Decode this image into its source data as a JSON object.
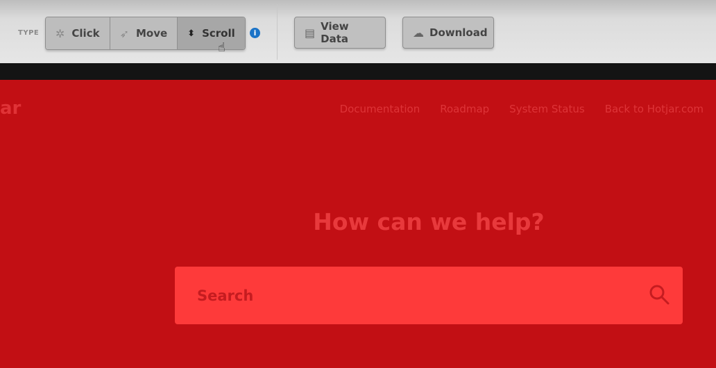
{
  "toolbar": {
    "type_label": "TYPE",
    "type_options": [
      {
        "label": "Click",
        "icon": "click-icon",
        "selected": false
      },
      {
        "label": "Move",
        "icon": "move-icon",
        "selected": false
      },
      {
        "label": "Scroll",
        "icon": "scroll-icon",
        "selected": true
      }
    ],
    "view_data_label": "View Data",
    "download_label": "Download"
  },
  "site": {
    "logo_fragment": "ar",
    "nav": [
      "Documentation",
      "Roadmap",
      "System Status",
      "Back to Hotjar.com"
    ],
    "heading": "How can we help?",
    "search_placeholder": "Search"
  },
  "colors": {
    "overlay_red": "#c20f14",
    "search_box": "#fe3a3a",
    "info_blue": "#1b73c7"
  }
}
